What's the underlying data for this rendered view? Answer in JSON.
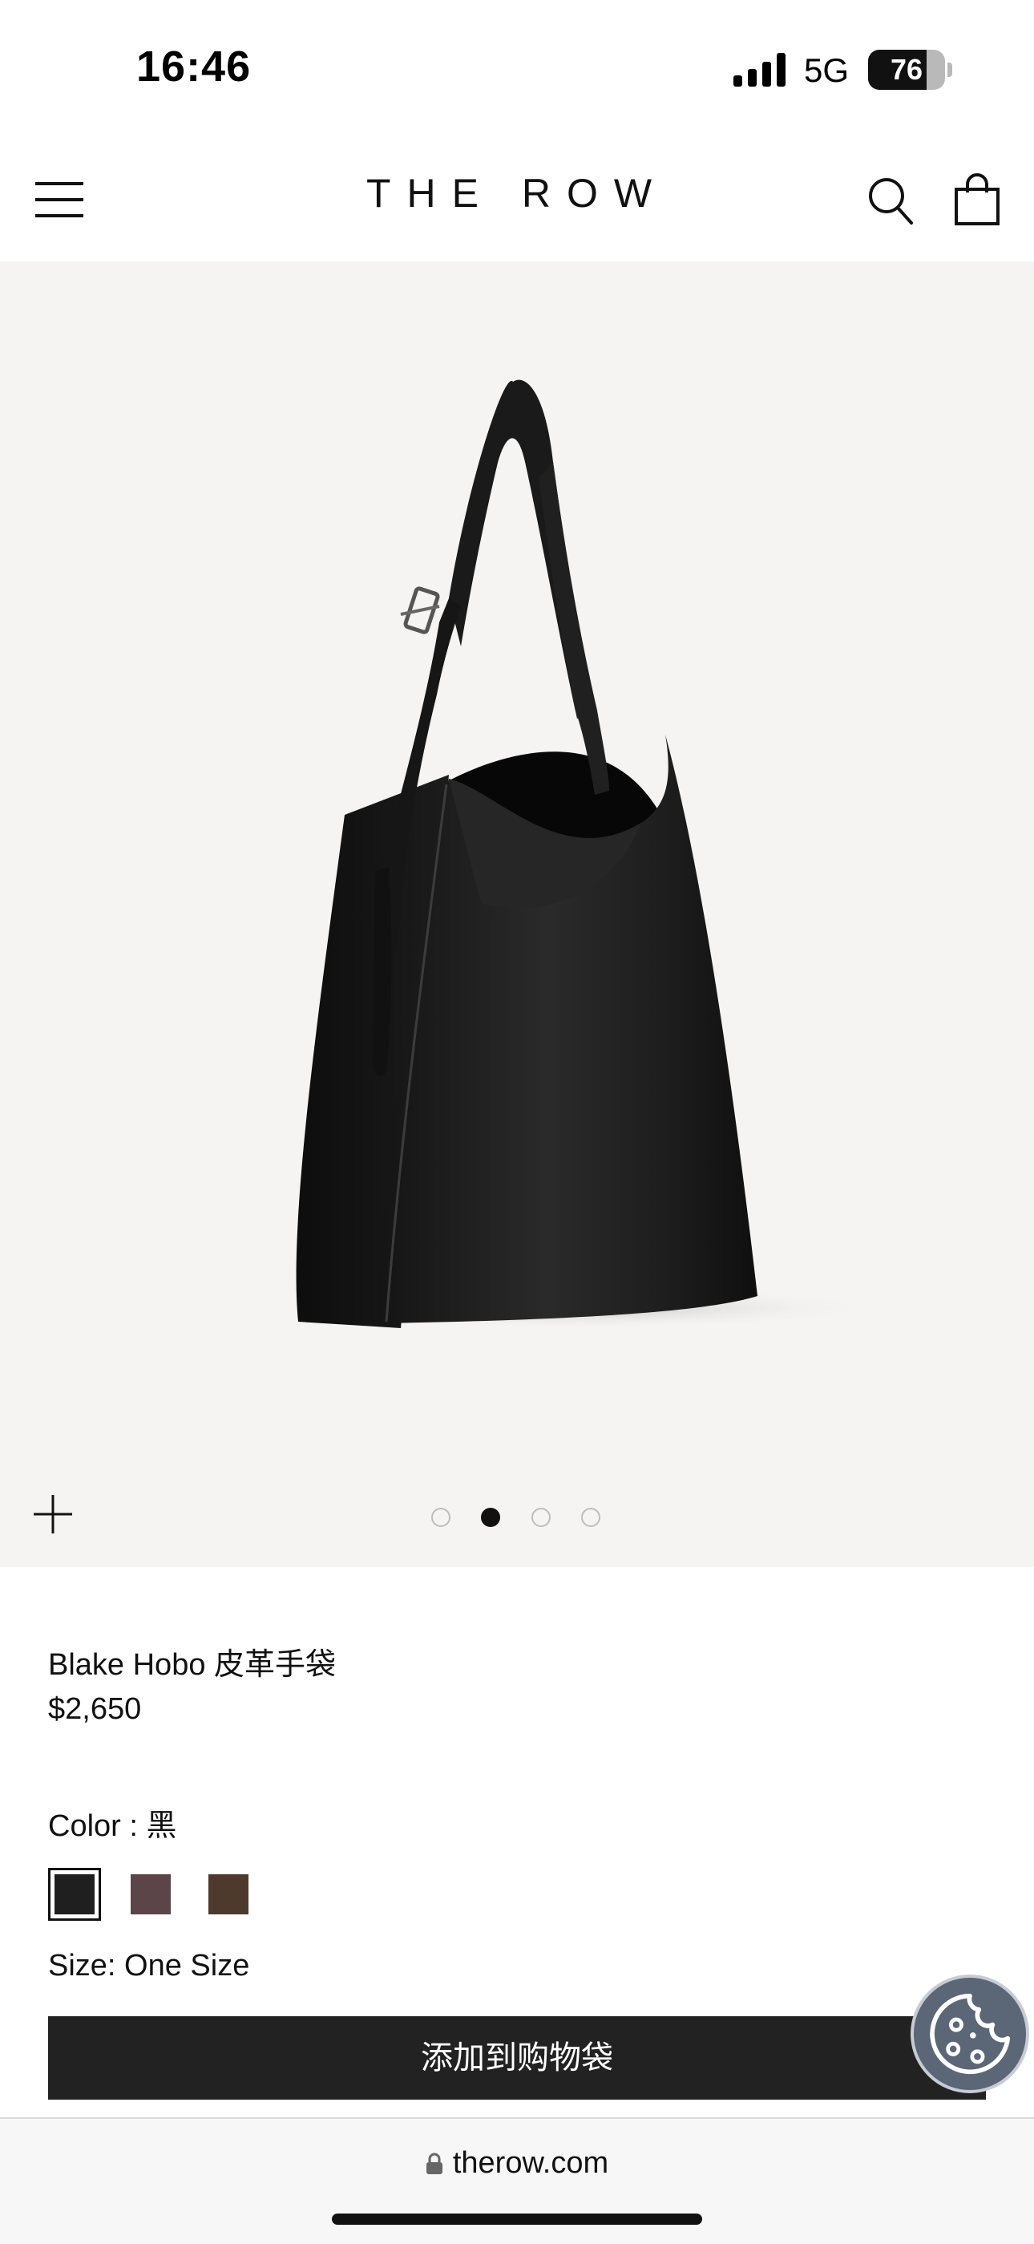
{
  "status_bar": {
    "time": "16:46",
    "network": "5G",
    "battery_level": "76",
    "battery_fraction": 0.76,
    "icons": [
      "signal-icon",
      "battery-icon"
    ]
  },
  "header": {
    "brand": "THE ROW",
    "icons": [
      "menu-icon",
      "search-icon",
      "shopping-bag-icon"
    ]
  },
  "gallery": {
    "slide_count": 4,
    "active_slide": 2,
    "background": "#f5f4f2",
    "zoom_icon": "plus-icon"
  },
  "product": {
    "name": "Blake Hobo 皮革手袋",
    "price": "$2,650",
    "color_label": "Color : 黑",
    "size_label": "Size: One Size",
    "add_to_bag": "添加到购物袋",
    "swatches": [
      {
        "color": "#1f1f1f",
        "selected": true
      },
      {
        "color": "#5b4548",
        "selected": false
      },
      {
        "color": "#4e3a2c",
        "selected": false
      }
    ]
  },
  "cookie_button": {
    "icon": "cookie-icon"
  },
  "browser": {
    "url": "therow.com",
    "lock_icon": "lock-icon"
  }
}
